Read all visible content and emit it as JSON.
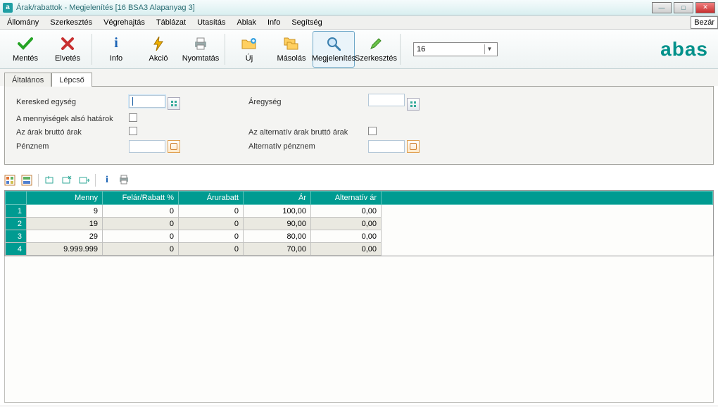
{
  "window": {
    "title": "Árak/rabattok - Megjelenítés  [16   BSA3   Alapanyag 3]",
    "bezar_label": "Bezár"
  },
  "menu": {
    "items": [
      "Állomány",
      "Szerkesztés",
      "Végrehajtás",
      "Táblázat",
      "Utasítás",
      "Ablak",
      "Info",
      "Segítség"
    ]
  },
  "toolbar": {
    "mentes": "Mentés",
    "elvetes": "Elvetés",
    "info": "Info",
    "akcio": "Akció",
    "nyomtatas": "Nyomtatás",
    "uj": "Új",
    "masolas": "Másolás",
    "megjelenites": "Megjelenítés",
    "szerkesztes": "Szerkesztés",
    "record_selector": "16"
  },
  "brand": "abas",
  "tabs": {
    "altalanos": "Általános",
    "lepcso": "Lépcső"
  },
  "form": {
    "keresked_egyseg": "Keresked egység",
    "aregyseg": "Áregység",
    "menny_also": "A mennyiségek alsó határok",
    "arak_brutto": "Az árak bruttó árak",
    "alt_brutto": "Az alternatív árak bruttó árak",
    "penznem": "Pénznem",
    "alt_penznem": "Alternatív pénznem"
  },
  "grid": {
    "headers": {
      "menny": "Menny",
      "felar": "Felár/Rabatt %",
      "arurabatt": "Árurabatt",
      "ar": "Ár",
      "alt_ar": "Alternatív ár"
    },
    "rows": [
      {
        "n": "1",
        "menny": "9",
        "felar": "0",
        "arurabatt": "0",
        "ar": "100,00",
        "alt": "0,00"
      },
      {
        "n": "2",
        "menny": "19",
        "felar": "0",
        "arurabatt": "0",
        "ar": "90,00",
        "alt": "0,00"
      },
      {
        "n": "3",
        "menny": "29",
        "felar": "0",
        "arurabatt": "0",
        "ar": "80,00",
        "alt": "0,00"
      },
      {
        "n": "4",
        "menny": "9.999.999",
        "felar": "0",
        "arurabatt": "0",
        "ar": "70,00",
        "alt": "0,00"
      }
    ]
  }
}
